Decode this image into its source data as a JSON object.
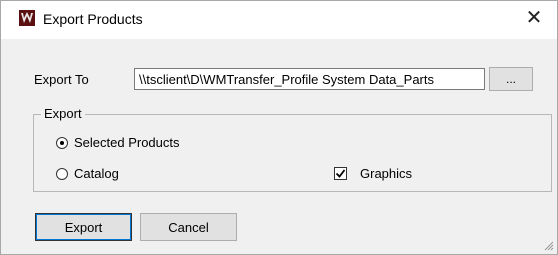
{
  "window": {
    "title": "Export Products",
    "close_glyph": "✕",
    "icon": "app-logo-icon"
  },
  "export_to": {
    "label": "Export To",
    "value": "\\\\tsclient\\D\\WMTransfer_Profile System Data_Parts",
    "browse_label": "..."
  },
  "export_group": {
    "title": "Export",
    "options": [
      {
        "label": "Selected Products",
        "selected": true
      },
      {
        "label": "Catalog",
        "selected": false
      }
    ],
    "graphics": {
      "label": "Graphics",
      "checked": true
    }
  },
  "buttons": {
    "export_label": "Export",
    "cancel_label": "Cancel"
  },
  "colors": {
    "titlebar": "#ffffff",
    "dialog_bg": "#f0f0f0",
    "focus_accent": "#0078d7"
  }
}
